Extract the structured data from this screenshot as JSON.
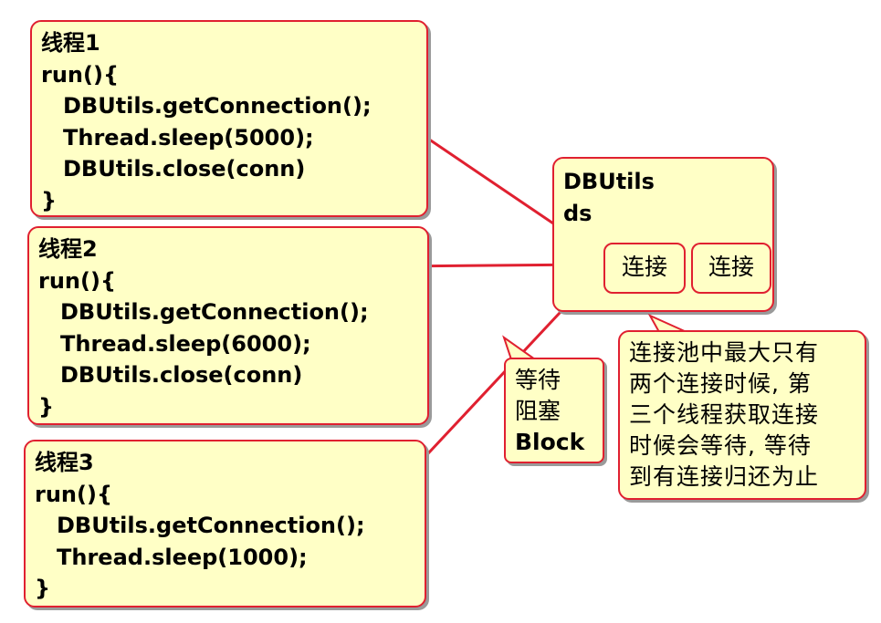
{
  "threads": [
    {
      "title": "线程1",
      "lines": [
        "run(){",
        "DBUtils.getConnection();",
        "Thread.sleep(5000);",
        "DBUtils.close(conn)",
        "}"
      ]
    },
    {
      "title": "线程2",
      "lines": [
        "run(){",
        "DBUtils.getConnection();",
        "Thread.sleep(6000);",
        "DBUtils.close(conn)",
        "}"
      ]
    },
    {
      "title": "线程3",
      "lines": [
        "run(){",
        "DBUtils.getConnection();",
        "Thread.sleep(1000);",
        "}"
      ]
    }
  ],
  "pool": {
    "title": "DBUtils",
    "subtitle": "ds",
    "connections": [
      "连接",
      "连接"
    ]
  },
  "block_note": [
    "等待",
    "阻塞",
    "Block"
  ],
  "explanation": [
    "连接池中最大只有",
    "两个连接时候, 第",
    "三个线程获取连接",
    "时候会等待, 等待",
    "到有连接归还为止"
  ],
  "colors": {
    "box_fill": "#ffffc6",
    "border": "#e02030",
    "arrow": "#e02030"
  }
}
